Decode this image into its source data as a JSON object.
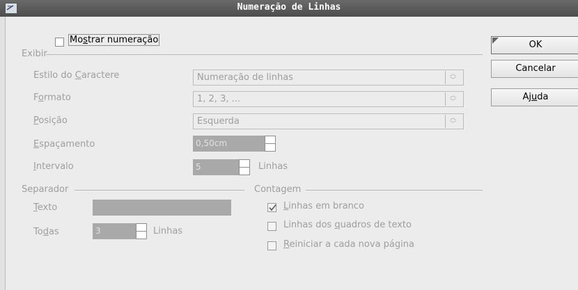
{
  "window": {
    "title": "Numeração de Linhas"
  },
  "show_numbering": {
    "label_pre": "Mo",
    "label_u": "s",
    "label_post": "trar numeração",
    "checked": false
  },
  "view": {
    "legend": "Exibir",
    "char_style": {
      "label_pre": "Estilo do ",
      "label_u": "C",
      "label_post": "aractere",
      "value": "Numeração de linhas"
    },
    "format": {
      "label_pre": "F",
      "label_u": "o",
      "label_post": "rmato",
      "value": "1, 2, 3, ..."
    },
    "position": {
      "label_pre": "",
      "label_u": "P",
      "label_post": "osição",
      "value": "Esquerda"
    },
    "spacing": {
      "label_pre": "",
      "label_u": "E",
      "label_post": "spaçamento",
      "value": "0,50cm"
    },
    "interval": {
      "label_pre": "",
      "label_u": "I",
      "label_post": "ntervalo",
      "value": "5",
      "unit": "Linhas"
    }
  },
  "separator": {
    "legend": "Separador",
    "text": {
      "label_pre": "",
      "label_u": "T",
      "label_post": "exto",
      "value": ""
    },
    "every": {
      "label_pre": "To",
      "label_u": "d",
      "label_post": "as",
      "value": "3",
      "unit": "Linhas"
    }
  },
  "count": {
    "legend": "Contagem",
    "blank_lines": {
      "label_pre": "",
      "label_u": "L",
      "label_post": "inhas em branco",
      "checked": true
    },
    "text_frames": {
      "label_pre": "Linhas dos ",
      "label_u": "q",
      "label_post": "uadros de texto",
      "checked": false
    },
    "restart": {
      "label_pre": "",
      "label_u": "R",
      "label_post": "einiciar a cada nova página",
      "checked": false
    }
  },
  "buttons": {
    "ok": "OK",
    "cancel": "Cancelar",
    "help_pre": "Aj",
    "help_u": "u",
    "help_post": "da"
  }
}
